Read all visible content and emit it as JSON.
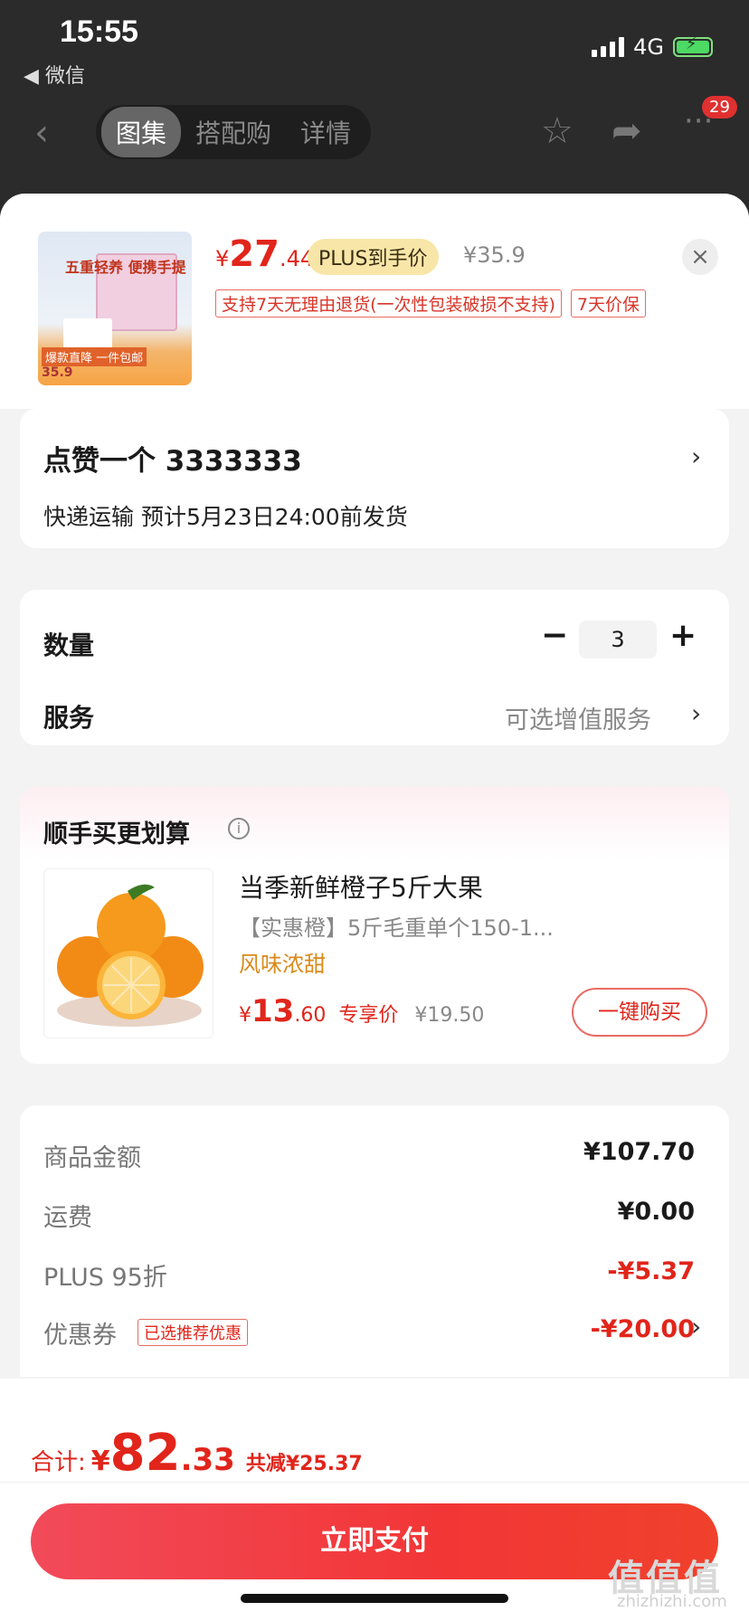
{
  "status": {
    "time": "15:55",
    "back_app": "◀ 微信",
    "network": "4G"
  },
  "nav": {
    "tabs": [
      "图集",
      "搭配购",
      "详情"
    ],
    "badge": "29"
  },
  "product": {
    "price_yen": "¥",
    "price_int": "27",
    "price_dec": ".44",
    "plus_tag": "PLUS到手价",
    "old_price": "¥35.9",
    "tags": [
      "支持7天无理由退货(一次性包装破损不支持)",
      "7天价保"
    ],
    "thumb_text": [
      "五重轻养 便携手提",
      "爆款直降 一件包邮",
      "35.9"
    ]
  },
  "address": {
    "name": "点赞一个 3333333",
    "delivery": "快递运输 预计5月23日24:00前发货"
  },
  "options": {
    "qty_label": "数量",
    "qty_value": "3",
    "minus": "−",
    "plus": "+",
    "service_label": "服务",
    "service_value": "可选增值服务"
  },
  "recommend": {
    "title": "顺手买更划算",
    "name": "当季新鲜橙子5斤大果",
    "desc": "【实惠橙】5斤毛重单个150-1...",
    "flavor": "风味浓甜",
    "price_yen": "¥",
    "price_int": "13",
    "price_dec": ".60",
    "exclusive": "专享价",
    "old_price": "¥19.50",
    "buy_label": "一键购买"
  },
  "summary": {
    "rows": [
      {
        "label": "商品金额",
        "value": "¥107.70"
      },
      {
        "label": "运费",
        "value": "¥0.00"
      },
      {
        "label": "PLUS 95折",
        "value": "-¥5.37"
      },
      {
        "label": "优惠券",
        "value": "-¥20.00",
        "tag": "已选推荐优惠"
      }
    ]
  },
  "footer": {
    "total_label": "合计:",
    "total_yen": "¥",
    "total_int": "82",
    "total_dec": ".33",
    "saved": "共减¥25.37",
    "pay_label": "立即支付"
  },
  "watermark": {
    "main": "值值值",
    "sub": "zhizhizhi.com"
  },
  "colors": {
    "accent": "#e1251b",
    "plus_gold": "#f8e6a8",
    "flavor": "#d98a1b"
  }
}
